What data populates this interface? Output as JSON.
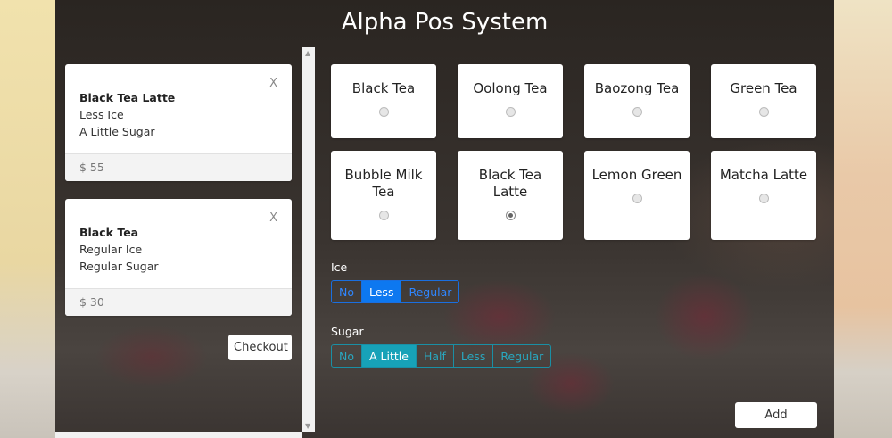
{
  "header": {
    "title": "Alpha Pos System"
  },
  "orders": [
    {
      "name": "Black Tea Latte",
      "ice": "Less Ice",
      "sugar": "A Little Sugar",
      "price": "$ 55",
      "close": "X"
    },
    {
      "name": "Black Tea",
      "ice": "Regular Ice",
      "sugar": "Regular Sugar",
      "price": "$ 30",
      "close": "X"
    }
  ],
  "checkout_label": "Checkout",
  "products": [
    {
      "name": "Black Tea",
      "selected": false
    },
    {
      "name": "Oolong Tea",
      "selected": false
    },
    {
      "name": "Baozong Tea",
      "selected": false
    },
    {
      "name": "Green Tea",
      "selected": false
    },
    {
      "name": "Bubble Milk Tea",
      "selected": false
    },
    {
      "name": "Black Tea Latte",
      "selected": true
    },
    {
      "name": "Lemon Green",
      "selected": false
    },
    {
      "name": "Matcha Latte",
      "selected": false
    }
  ],
  "ice": {
    "label": "Ice",
    "options": [
      "No",
      "Less",
      "Regular"
    ],
    "selected": "Less"
  },
  "sugar": {
    "label": "Sugar",
    "options": [
      "No",
      "A Little",
      "Half",
      "Less",
      "Regular"
    ],
    "selected": "A Little"
  },
  "add_label": "Add",
  "colors": {
    "ice_accent": "#0d78f0",
    "sugar_accent": "#17a2b8"
  }
}
